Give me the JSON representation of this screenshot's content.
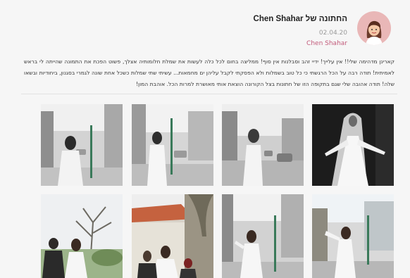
{
  "post": {
    "title": "החתונה של Chen Shahar",
    "date": "02.04.20",
    "author": "Chen Shahar",
    "text": "קארינן מדהימה שלי!! אין עלייך! ידיי זהב וסבלנות אין סוף! ממליצה בחום לכל כלה לעשות את שמלת חלומותיה אצלך, פשוט הפכת את התמונה שהייתה לי בראש לאמיתית! תודה רבה על הכל הרגשתי כי כל טוב בשמלות ולא הפסקתי לקבל עליהן ים מחמאות... עשיתי שתי שמלות כשכל אחת שונה לגמרי בסגנון, ביחודיות ובשאו שלה! תודה אהובה שלי שגם בתקופה הזו של חתונות בצל הקורונה הוצאת אותי מאושרת למרות הכל. אוהבת המון!"
  },
  "gallery": {
    "photos": [
      {
        "name": "photo-bride-veil-dark",
        "kind": "veil"
      },
      {
        "name": "photo-bride-lace-street",
        "kind": "street-bw"
      },
      {
        "name": "photo-bride-road-back",
        "kind": "street-bw"
      },
      {
        "name": "photo-bride-road-front",
        "kind": "street-bw"
      },
      {
        "name": "photo-bride-twirl-2",
        "kind": "twirl-color"
      },
      {
        "name": "photo-bride-twirl-1",
        "kind": "twirl-bw"
      },
      {
        "name": "photo-bride-with-family",
        "kind": "family-color"
      },
      {
        "name": "photo-couple-tree",
        "kind": "couple-color"
      }
    ]
  },
  "colors": {
    "accent": "#c25a7a",
    "avatar_bg": "#e9b7b7"
  }
}
